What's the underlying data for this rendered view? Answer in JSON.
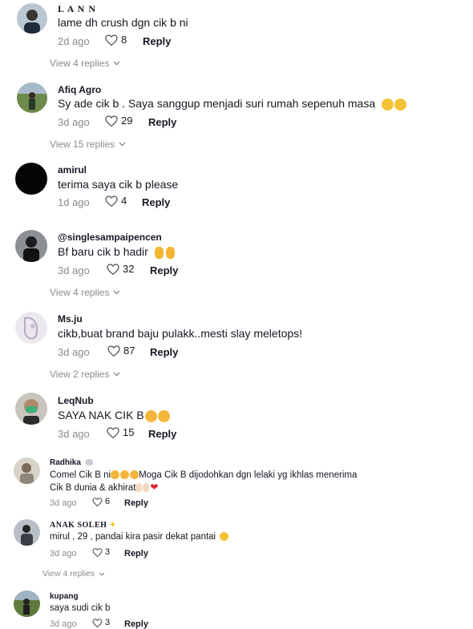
{
  "comments": [
    {
      "username": "L A N N",
      "text": "lame dh crush dgn cik b ni",
      "time": "2d ago",
      "likes": "8",
      "reply": "Reply",
      "view_replies": "View 4 replies"
    },
    {
      "username": "Afiq Agro",
      "text": "Sy ade cik b . Saya sanggup menjadi suri rumah sepenuh masa",
      "time": "3d ago",
      "likes": "29",
      "reply": "Reply",
      "view_replies": "View 15 replies"
    },
    {
      "username": "amirul",
      "text": "terima saya cik b please",
      "time": "1d ago",
      "likes": "4",
      "reply": "Reply"
    },
    {
      "username": "@singlesampaipencen",
      "text": "Bf baru cik b hadir",
      "time": "3d ago",
      "likes": "32",
      "reply": "Reply",
      "view_replies": "View 4 replies"
    },
    {
      "username": "Ms.ju",
      "text": "cikb,buat brand baju pulakk..mesti slay meletops!",
      "time": "3d ago",
      "likes": "87",
      "reply": "Reply",
      "view_replies": "View 2 replies"
    },
    {
      "username": "LeqNub",
      "text": "SAYA NAK CIK B",
      "time": "3d ago",
      "likes": "15",
      "reply": "Reply"
    },
    {
      "username": "Radhika",
      "text_line1_a": "Comel Cik B ni",
      "text_line1_b": "Moga Cik B dijodohkan dgn lelaki yg ikhlas menerima",
      "text_line2": "Cik B dunia & akhirat",
      "time": "3d ago",
      "likes": "6",
      "reply": "Reply"
    },
    {
      "username": "ANAK SOLEH",
      "text": "mirul , 29 , pandai kira pasir dekat pantai",
      "time": "3d ago",
      "likes": "3",
      "reply": "Reply",
      "view_replies": "View 4 replies"
    },
    {
      "username": "kupang",
      "text": "saya sudi cik b",
      "time": "3d ago",
      "likes": "3",
      "reply": "Reply"
    }
  ],
  "icons": {
    "like": "heart-outline-icon",
    "expand": "chevron-down-icon"
  }
}
